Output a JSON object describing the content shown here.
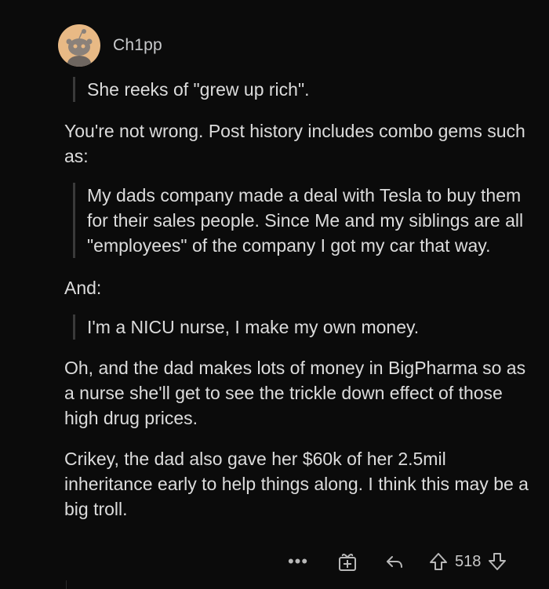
{
  "comment": {
    "username": "Ch1pp",
    "quote_1": "She reeks of \"grew up rich\".",
    "para_1": "You're not wrong. Post history includes combo gems such as:",
    "quote_2": "My dads company made a deal with Tesla to buy them for their sales people. Since Me and my siblings are all \"employees\" of the company I got my car that way.",
    "para_2": "And:",
    "quote_3": "I'm a NICU nurse, I make my own money.",
    "para_3": "Oh, and the dad makes lots of money in BigPharma so as a nurse she'll get to see the trickle down effect of those high drug prices.",
    "para_4": "Crikey, the dad also gave her $60k of her 2.5mil inheritance early to help things along. I think this may be a big troll."
  },
  "actions": {
    "more_label": "•••",
    "score": "518"
  },
  "icons": {
    "avatar": "reddit-snoo-avatar",
    "more": "more-icon",
    "award": "award-icon",
    "reply": "reply-icon",
    "upvote": "upvote-icon",
    "downvote": "downvote-icon"
  },
  "colors": {
    "background": "#0b0b0b",
    "text": "#dcdcdc",
    "avatar_bg": "#e8b985",
    "quote_bar": "#3a3a3a"
  }
}
